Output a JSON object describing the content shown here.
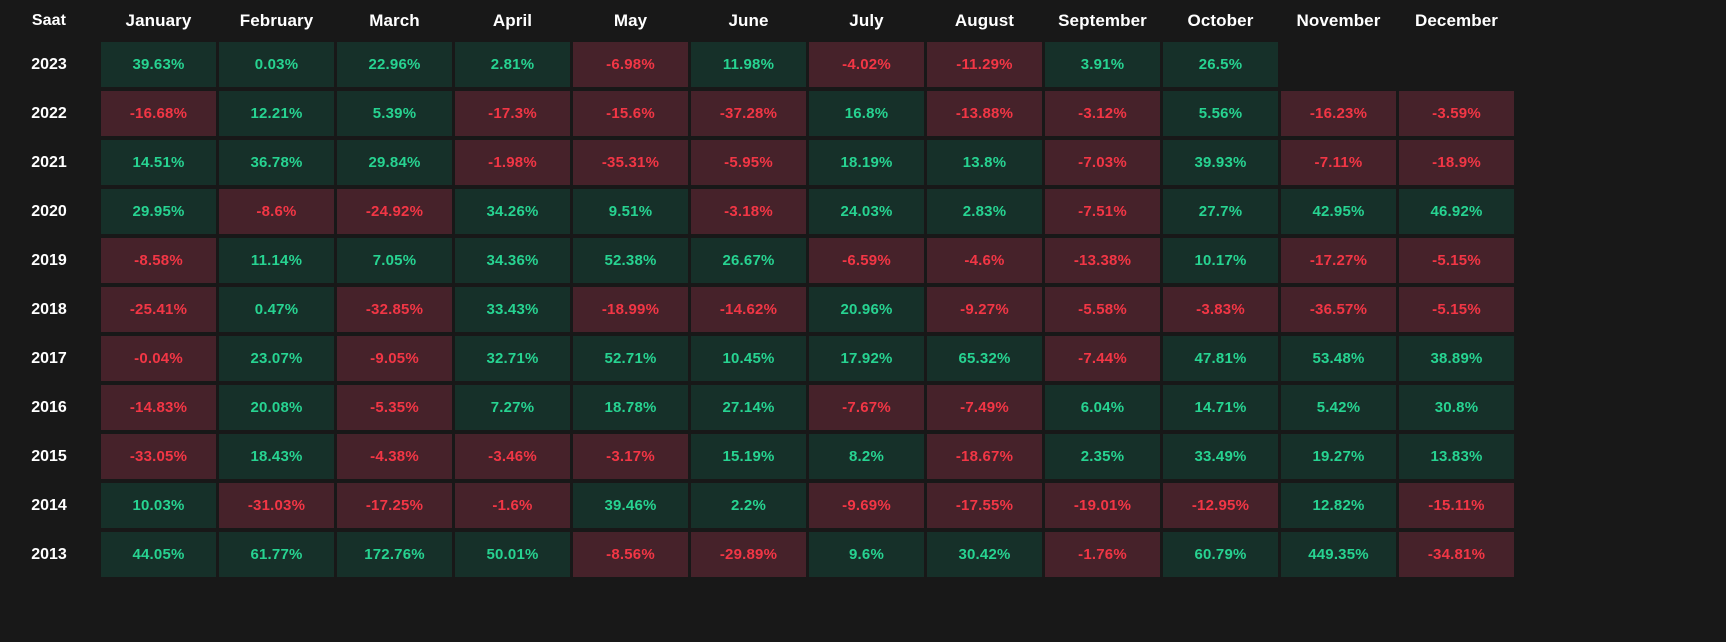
{
  "panel": {
    "name": "monthly-returns-heatmap",
    "background": "#181818"
  },
  "colors": {
    "positive_bg": "#163029",
    "positive_text": "#27d391",
    "negative_bg": "#46222a",
    "negative_text": "#f23645",
    "header_text": "#ffffff",
    "panel_bg": "#181818"
  },
  "chart_data": {
    "type": "heatmap",
    "title": "",
    "xlabel": "",
    "ylabel": "Saat",
    "grid": true,
    "legend_position": "none",
    "value_suffix": "%",
    "row_header_label": "Saat",
    "categories": [
      "January",
      "February",
      "March",
      "April",
      "May",
      "June",
      "July",
      "August",
      "September",
      "October",
      "November",
      "December"
    ],
    "rows": [
      {
        "year": "2023",
        "values": [
          "39.63%",
          "0.03%",
          "22.96%",
          "2.81%",
          "-6.98%",
          "11.98%",
          "-4.02%",
          "-11.29%",
          "3.91%",
          "26.5%",
          "",
          ""
        ],
        "numbers": [
          39.63,
          0.03,
          22.96,
          2.81,
          -6.98,
          11.98,
          -4.02,
          -11.29,
          3.91,
          26.5,
          null,
          null
        ]
      },
      {
        "year": "2022",
        "values": [
          "-16.68%",
          "12.21%",
          "5.39%",
          "-17.3%",
          "-15.6%",
          "-37.28%",
          "16.8%",
          "-13.88%",
          "-3.12%",
          "5.56%",
          "-16.23%",
          "-3.59%"
        ],
        "numbers": [
          -16.68,
          12.21,
          5.39,
          -17.3,
          -15.6,
          -37.28,
          16.8,
          -13.88,
          -3.12,
          5.56,
          -16.23,
          -3.59
        ]
      },
      {
        "year": "2021",
        "values": [
          "14.51%",
          "36.78%",
          "29.84%",
          "-1.98%",
          "-35.31%",
          "-5.95%",
          "18.19%",
          "13.8%",
          "-7.03%",
          "39.93%",
          "-7.11%",
          "-18.9%"
        ],
        "numbers": [
          14.51,
          36.78,
          29.84,
          -1.98,
          -35.31,
          -5.95,
          18.19,
          13.8,
          -7.03,
          39.93,
          -7.11,
          -18.9
        ]
      },
      {
        "year": "2020",
        "values": [
          "29.95%",
          "-8.6%",
          "-24.92%",
          "34.26%",
          "9.51%",
          "-3.18%",
          "24.03%",
          "2.83%",
          "-7.51%",
          "27.7%",
          "42.95%",
          "46.92%"
        ],
        "numbers": [
          29.95,
          -8.6,
          -24.92,
          34.26,
          9.51,
          -3.18,
          24.03,
          2.83,
          -7.51,
          27.7,
          42.95,
          46.92
        ]
      },
      {
        "year": "2019",
        "values": [
          "-8.58%",
          "11.14%",
          "7.05%",
          "34.36%",
          "52.38%",
          "26.67%",
          "-6.59%",
          "-4.6%",
          "-13.38%",
          "10.17%",
          "-17.27%",
          "-5.15%"
        ],
        "numbers": [
          -8.58,
          11.14,
          7.05,
          34.36,
          52.38,
          26.67,
          -6.59,
          -4.6,
          -13.38,
          10.17,
          -17.27,
          -5.15
        ]
      },
      {
        "year": "2018",
        "values": [
          "-25.41%",
          "0.47%",
          "-32.85%",
          "33.43%",
          "-18.99%",
          "-14.62%",
          "20.96%",
          "-9.27%",
          "-5.58%",
          "-3.83%",
          "-36.57%",
          "-5.15%"
        ],
        "numbers": [
          -25.41,
          0.47,
          -32.85,
          33.43,
          -18.99,
          -14.62,
          20.96,
          -9.27,
          -5.58,
          -3.83,
          -36.57,
          -5.15
        ]
      },
      {
        "year": "2017",
        "values": [
          "-0.04%",
          "23.07%",
          "-9.05%",
          "32.71%",
          "52.71%",
          "10.45%",
          "17.92%",
          "65.32%",
          "-7.44%",
          "47.81%",
          "53.48%",
          "38.89%"
        ],
        "numbers": [
          -0.04,
          23.07,
          -9.05,
          32.71,
          52.71,
          10.45,
          17.92,
          65.32,
          -7.44,
          47.81,
          53.48,
          38.89
        ]
      },
      {
        "year": "2016",
        "values": [
          "-14.83%",
          "20.08%",
          "-5.35%",
          "7.27%",
          "18.78%",
          "27.14%",
          "-7.67%",
          "-7.49%",
          "6.04%",
          "14.71%",
          "5.42%",
          "30.8%"
        ],
        "numbers": [
          -14.83,
          20.08,
          -5.35,
          7.27,
          18.78,
          27.14,
          -7.67,
          -7.49,
          6.04,
          14.71,
          5.42,
          30.8
        ]
      },
      {
        "year": "2015",
        "values": [
          "-33.05%",
          "18.43%",
          "-4.38%",
          "-3.46%",
          "-3.17%",
          "15.19%",
          "8.2%",
          "-18.67%",
          "2.35%",
          "33.49%",
          "19.27%",
          "13.83%"
        ],
        "numbers": [
          -33.05,
          18.43,
          -4.38,
          -3.46,
          -3.17,
          15.19,
          8.2,
          -18.67,
          2.35,
          33.49,
          19.27,
          13.83
        ]
      },
      {
        "year": "2014",
        "values": [
          "10.03%",
          "-31.03%",
          "-17.25%",
          "-1.6%",
          "39.46%",
          "2.2%",
          "-9.69%",
          "-17.55%",
          "-19.01%",
          "-12.95%",
          "12.82%",
          "-15.11%"
        ],
        "numbers": [
          10.03,
          -31.03,
          -17.25,
          -1.6,
          39.46,
          2.2,
          -9.69,
          -17.55,
          -19.01,
          -12.95,
          12.82,
          -15.11
        ]
      },
      {
        "year": "2013",
        "values": [
          "44.05%",
          "61.77%",
          "172.76%",
          "50.01%",
          "-8.56%",
          "-29.89%",
          "9.6%",
          "30.42%",
          "-1.76%",
          "60.79%",
          "449.35%",
          "-34.81%"
        ],
        "numbers": [
          44.05,
          61.77,
          172.76,
          50.01,
          -8.56,
          -29.89,
          9.6,
          30.42,
          -1.76,
          60.79,
          449.35,
          -34.81
        ]
      }
    ]
  }
}
